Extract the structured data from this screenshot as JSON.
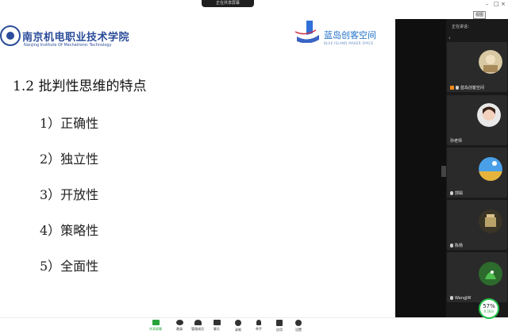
{
  "meeting": {
    "share_indicator": "正在共享屏幕",
    "view_button": "视图",
    "panel_title": "正在讲话："
  },
  "slide": {
    "school_name": "南京机电职业技术学院",
    "school_en": "Nanjing Institute Of Mechatronic Technology",
    "brand_name": "蓝岛创客空间",
    "brand_en": "BLUE ISLAND MAKER SPACE",
    "heading": "1.2 批判性思维的特点",
    "items": [
      "1）正确性",
      "2）独立性",
      "3）开放性",
      "4）策略性",
      "5）全面性"
    ]
  },
  "participants": [
    {
      "name": "蓝岛创客空间",
      "host": true
    },
    {
      "name": "孙老师",
      "host": false
    },
    {
      "name": "郭娟",
      "host": false
    },
    {
      "name": "陈杨",
      "host": false
    },
    {
      "name": "WangJW",
      "host": false
    }
  ],
  "toolbar": [
    {
      "label": "共享屏幕",
      "icon": "share-screen-icon",
      "active": true
    },
    {
      "label": "邀请",
      "icon": "invite-icon"
    },
    {
      "label": "管理成员",
      "icon": "members-icon"
    },
    {
      "label": "聊天",
      "icon": "chat-icon"
    },
    {
      "label": "录制",
      "icon": "record-icon"
    },
    {
      "label": "举手",
      "icon": "raise-hand-icon"
    },
    {
      "label": "应用",
      "icon": "apps-icon"
    },
    {
      "label": "设置",
      "icon": "settings-icon"
    }
  ],
  "network": {
    "percent": "57%",
    "speed": "0.1K/s"
  },
  "colors": {
    "accent": "#27a33a",
    "brand_blue": "#2b4c9a",
    "panel_bg": "#1a1a1a"
  }
}
